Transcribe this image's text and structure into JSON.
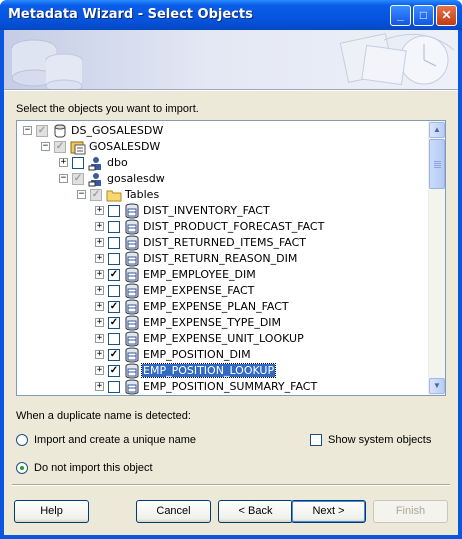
{
  "window": {
    "title": "Metadata Wizard - Select Objects"
  },
  "prompt": "Select the objects you want to import.",
  "tree": [
    {
      "label": "DS_GOSALESDW",
      "level": 0,
      "expander": "−",
      "check": "gray",
      "icon": "datasource"
    },
    {
      "label": "GOSALESDW",
      "level": 1,
      "expander": "−",
      "check": "gray",
      "icon": "database"
    },
    {
      "label": "dbo",
      "level": 2,
      "expander": "+",
      "check": "none",
      "icon": "schema"
    },
    {
      "label": "gosalesdw",
      "level": 2,
      "expander": "−",
      "check": "gray",
      "icon": "schema"
    },
    {
      "label": "Tables",
      "level": 3,
      "expander": "−",
      "check": "gray",
      "icon": "folder"
    },
    {
      "label": "DIST_INVENTORY_FACT",
      "level": 4,
      "expander": "+",
      "check": "none",
      "icon": "table"
    },
    {
      "label": "DIST_PRODUCT_FORECAST_FACT",
      "level": 4,
      "expander": "+",
      "check": "none",
      "icon": "table"
    },
    {
      "label": "DIST_RETURNED_ITEMS_FACT",
      "level": 4,
      "expander": "+",
      "check": "none",
      "icon": "table"
    },
    {
      "label": "DIST_RETURN_REASON_DIM",
      "level": 4,
      "expander": "+",
      "check": "none",
      "icon": "table"
    },
    {
      "label": "EMP_EMPLOYEE_DIM",
      "level": 4,
      "expander": "+",
      "check": "checked",
      "icon": "table"
    },
    {
      "label": "EMP_EXPENSE_FACT",
      "level": 4,
      "expander": "+",
      "check": "none",
      "icon": "table"
    },
    {
      "label": "EMP_EXPENSE_PLAN_FACT",
      "level": 4,
      "expander": "+",
      "check": "checked",
      "icon": "table"
    },
    {
      "label": "EMP_EXPENSE_TYPE_DIM",
      "level": 4,
      "expander": "+",
      "check": "checked",
      "icon": "table"
    },
    {
      "label": "EMP_EXPENSE_UNIT_LOOKUP",
      "level": 4,
      "expander": "+",
      "check": "none",
      "icon": "table"
    },
    {
      "label": "EMP_POSITION_DIM",
      "level": 4,
      "expander": "+",
      "check": "checked",
      "icon": "table"
    },
    {
      "label": "EMP_POSITION_LOOKUP",
      "level": 4,
      "expander": "+",
      "check": "checked",
      "icon": "table",
      "selected": true
    },
    {
      "label": "EMP_POSITION_SUMMARY_FACT",
      "level": 4,
      "expander": "+",
      "check": "none",
      "icon": "table"
    }
  ],
  "duplicate": {
    "heading": "When a duplicate name is detected:",
    "option_import": "Import and create a unique name",
    "option_skip": "Do not import this object",
    "selected": "skip",
    "show_system": "Show system objects",
    "show_system_checked": false
  },
  "buttons": {
    "help": "Help",
    "cancel": "Cancel",
    "back": "< Back",
    "next": "Next >",
    "finish": "Finish"
  },
  "colors": {
    "selection": "#316ac5",
    "titlebar": "#0a5ce8",
    "face": "#ece9d8"
  }
}
